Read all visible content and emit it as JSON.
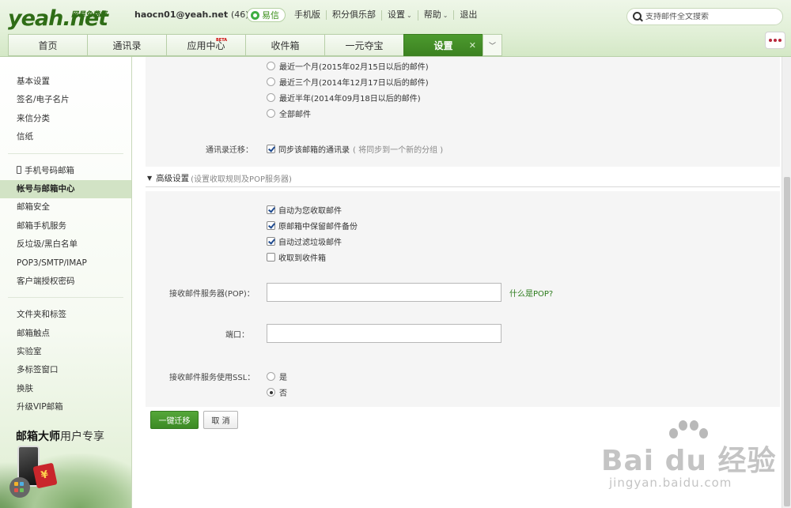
{
  "header": {
    "logo_main": "yeah.net",
    "logo_sub": "网易免费邮",
    "user_email": "haocn01@yeah.net",
    "user_count": "(46)",
    "yixin_label": "易信",
    "links": [
      "手机版",
      "积分俱乐部",
      "设置",
      "帮助",
      "退出"
    ],
    "search_placeholder": "支持邮件全文搜索"
  },
  "tabs": [
    {
      "label": "首页"
    },
    {
      "label": "通讯录"
    },
    {
      "label": "应用中心",
      "badge": "BETA"
    },
    {
      "label": "收件箱"
    },
    {
      "label": "一元夺宝"
    },
    {
      "label": "设置",
      "active": true
    }
  ],
  "sidebar": {
    "group1": [
      "基本设置",
      "签名/电子名片",
      "来信分类",
      "信纸"
    ],
    "group2": [
      "手机号码邮箱",
      "帐号与邮箱中心",
      "邮箱安全",
      "邮箱手机服务",
      "反垃圾/黑白名单",
      "POP3/SMTP/IMAP",
      "客户端授权密码"
    ],
    "group2_active_index": 1,
    "group3": [
      "文件夹和标签",
      "邮箱触点",
      "实验室",
      "多标签窗口",
      "换肤",
      "升级VIP邮箱"
    ],
    "promo_title_bold": "邮箱大师",
    "promo_title_rest": "用户专享"
  },
  "main": {
    "time_range_options": [
      {
        "label": "最近一个月(2015年02月15日以后的邮件)",
        "checked": false
      },
      {
        "label": "最近三个月(2014年12月17日以后的邮件)",
        "checked": false
      },
      {
        "label": "最近半年(2014年09月18日以后的邮件)",
        "checked": false
      },
      {
        "label": "全部邮件",
        "checked": false
      }
    ],
    "contacts_label": "通讯录迁移：",
    "contacts_checkbox": "同步该邮箱的通讯录",
    "contacts_hint": "( 将同步到一个新的分组 )",
    "advanced_title": "高级设置",
    "advanced_hint": "(设置收取规则及POP服务器)",
    "advanced_options": [
      {
        "label": "自动为您收取邮件",
        "checked": true
      },
      {
        "label": "原邮箱中保留邮件备份",
        "checked": true
      },
      {
        "label": "自动过滤垃圾邮件",
        "checked": true
      },
      {
        "label": "收取到收件箱",
        "checked": false
      }
    ],
    "pop_label": "接收邮件服务器(POP)：",
    "pop_value": "",
    "pop_help": "什么是POP?",
    "port_label": "端口：",
    "port_value": "",
    "ssl_label": "接收邮件服务使用SSL：",
    "ssl_options": [
      {
        "label": "是",
        "checked": false
      },
      {
        "label": "否",
        "checked": true
      }
    ],
    "submit_label": "一键迁移",
    "cancel_label": "取 消"
  },
  "watermark": {
    "text": "Bai du 经验",
    "url": "jingyan.baidu.com"
  }
}
